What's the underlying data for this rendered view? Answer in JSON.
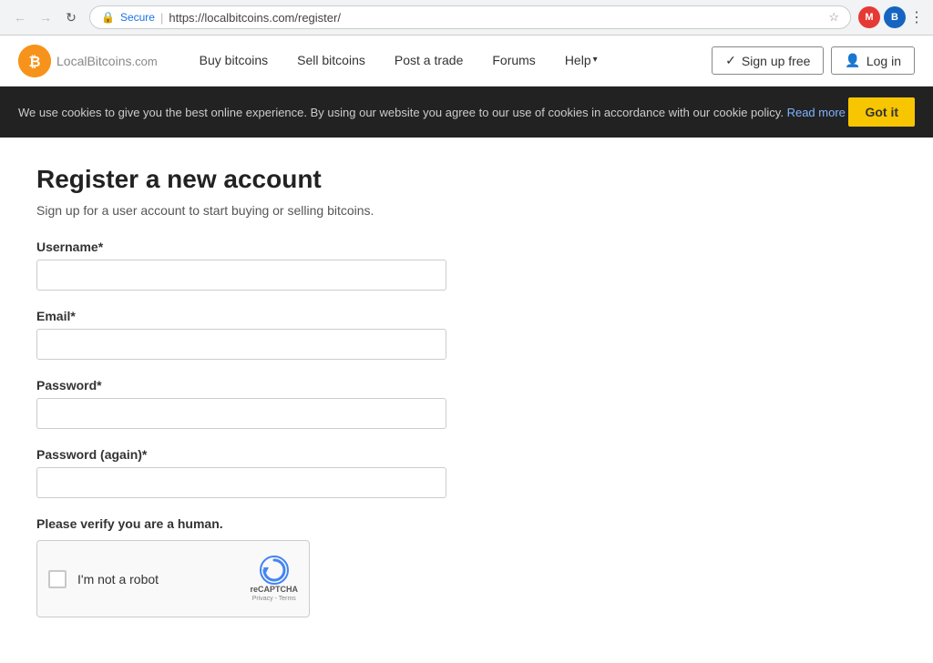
{
  "browser": {
    "back_disabled": true,
    "forward_disabled": true,
    "secure_label": "Secure",
    "url": "https://localbitcoins.com/register/",
    "extensions": [
      "M",
      "B",
      "⋮"
    ]
  },
  "navbar": {
    "logo_letter": "₿",
    "logo_name": "LocalBitcoins",
    "logo_suffix": ".com",
    "nav_links": [
      {
        "label": "Buy bitcoins",
        "dropdown": false
      },
      {
        "label": "Sell bitcoins",
        "dropdown": false
      },
      {
        "label": "Post a trade",
        "dropdown": false
      },
      {
        "label": "Forums",
        "dropdown": false
      },
      {
        "label": "Help",
        "dropdown": true
      }
    ],
    "signup_label": "Sign up free",
    "login_label": "Log in"
  },
  "cookie_banner": {
    "text": "We use cookies to give you the best online experience. By using our website you agree to our use of cookies in accordance with our cookie policy.",
    "read_more_label": "Read more",
    "got_it_label": "Got it"
  },
  "page": {
    "title": "Register a new account",
    "subtitle": "Sign up for a user account to start buying or selling bitcoins.",
    "fields": [
      {
        "label": "Username*",
        "type": "text",
        "name": "username"
      },
      {
        "label": "Email*",
        "type": "email",
        "name": "email"
      },
      {
        "label": "Password*",
        "type": "password",
        "name": "password"
      },
      {
        "label": "Password (again)*",
        "type": "password",
        "name": "password_confirm"
      }
    ],
    "captcha_label": "Please verify you are a human.",
    "captcha_checkbox_label": "I'm not a robot",
    "captcha_brand": "reCAPTCHA",
    "captcha_sub": "Privacy - Terms"
  }
}
